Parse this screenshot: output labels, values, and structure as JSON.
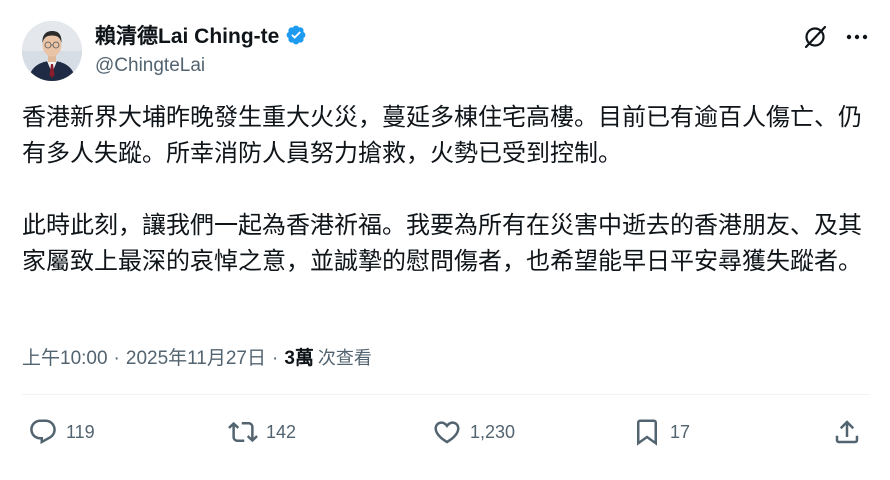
{
  "author": {
    "display_name": "賴清德Lai Ching-te",
    "handle": "@ChingteLai",
    "verified": true,
    "verified_color": "#1d9bf0"
  },
  "header": {
    "grok_icon": "grok-icon",
    "more_icon": "more-icon"
  },
  "tweet": {
    "paragraph_1": "香港新界大埔昨晚發生重大火災，蔓延多棟住宅高樓。目前已有逾百人傷亡、仍有多人失蹤。所幸消防人員努力搶救，火勢已受到控制。",
    "paragraph_2": "此時此刻，讓我們一起為香港祈福。我要為所有在災害中逝去的香港朋友、及其家屬致上最深的哀悼之意，並誠摯的慰問傷者，也希望能早日平安尋獲失蹤者。"
  },
  "meta": {
    "time": "上午10:00",
    "separator": "·",
    "date": "2025年11月27日",
    "views_count": "3萬",
    "views_label": "次查看"
  },
  "actions": {
    "reply_count": "119",
    "repost_count": "142",
    "like_count": "1,230",
    "bookmark_count": "17"
  },
  "colors": {
    "text": "#0f1419",
    "secondary": "#536471",
    "divider": "#eff3f4"
  }
}
